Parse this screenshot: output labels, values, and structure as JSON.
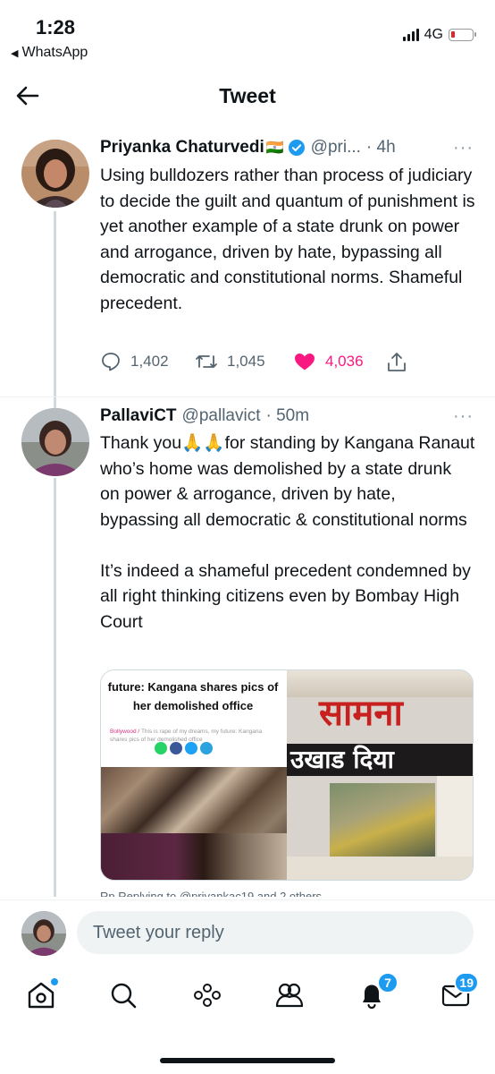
{
  "status_bar": {
    "time": "1:28",
    "back_app": "WhatsApp",
    "network": "4G"
  },
  "header": {
    "title": "Tweet"
  },
  "tweet": {
    "name": "Priyanka Chaturvedi",
    "flag": "🇮🇳",
    "handle": "@pri...",
    "time": "· 4h",
    "more": "···",
    "text": "Using bulldozers rather than process of judiciary to decide the guilt and quantum of punishment is yet another example of a state drunk on power and arrogance, driven by hate, bypassing all democratic and constitutional norms. Shameful precedent.",
    "replies": "1,402",
    "retweets": "1,045",
    "likes": "4,036"
  },
  "reply_tweet": {
    "name": "PallaviCT",
    "handle": "@pallavict",
    "time": "· 50m",
    "more": "···",
    "text": "Thank you🙏🙏for standing by Kangana Ranaut who’s home was demolished by a state drunk on power & arrogance, driven by hate, bypassing all democratic & constitutional norms\n\nIt’s indeed a shameful precedent condemned by all right thinking citizens even by Bombay High Court",
    "media_left": {
      "title": "future: Kangana shares pics of her demolished office",
      "category": "Bollywood /",
      "caption": "This is rape of my dreams, my future: Kangana shares pics of her demolished office"
    },
    "media_right": {
      "masthead": "सामना",
      "headline": "उखाड दिया"
    },
    "truncated_line": "Rp     Replying to @priyankac19 and 2 others"
  },
  "reply_box": {
    "placeholder": "Tweet your reply"
  },
  "tab_bar": {
    "notifications_count": "7",
    "messages_count": "19"
  },
  "colors": {
    "accent": "#1d9bf0",
    "like": "#f91880",
    "secondary_text": "#536471"
  }
}
